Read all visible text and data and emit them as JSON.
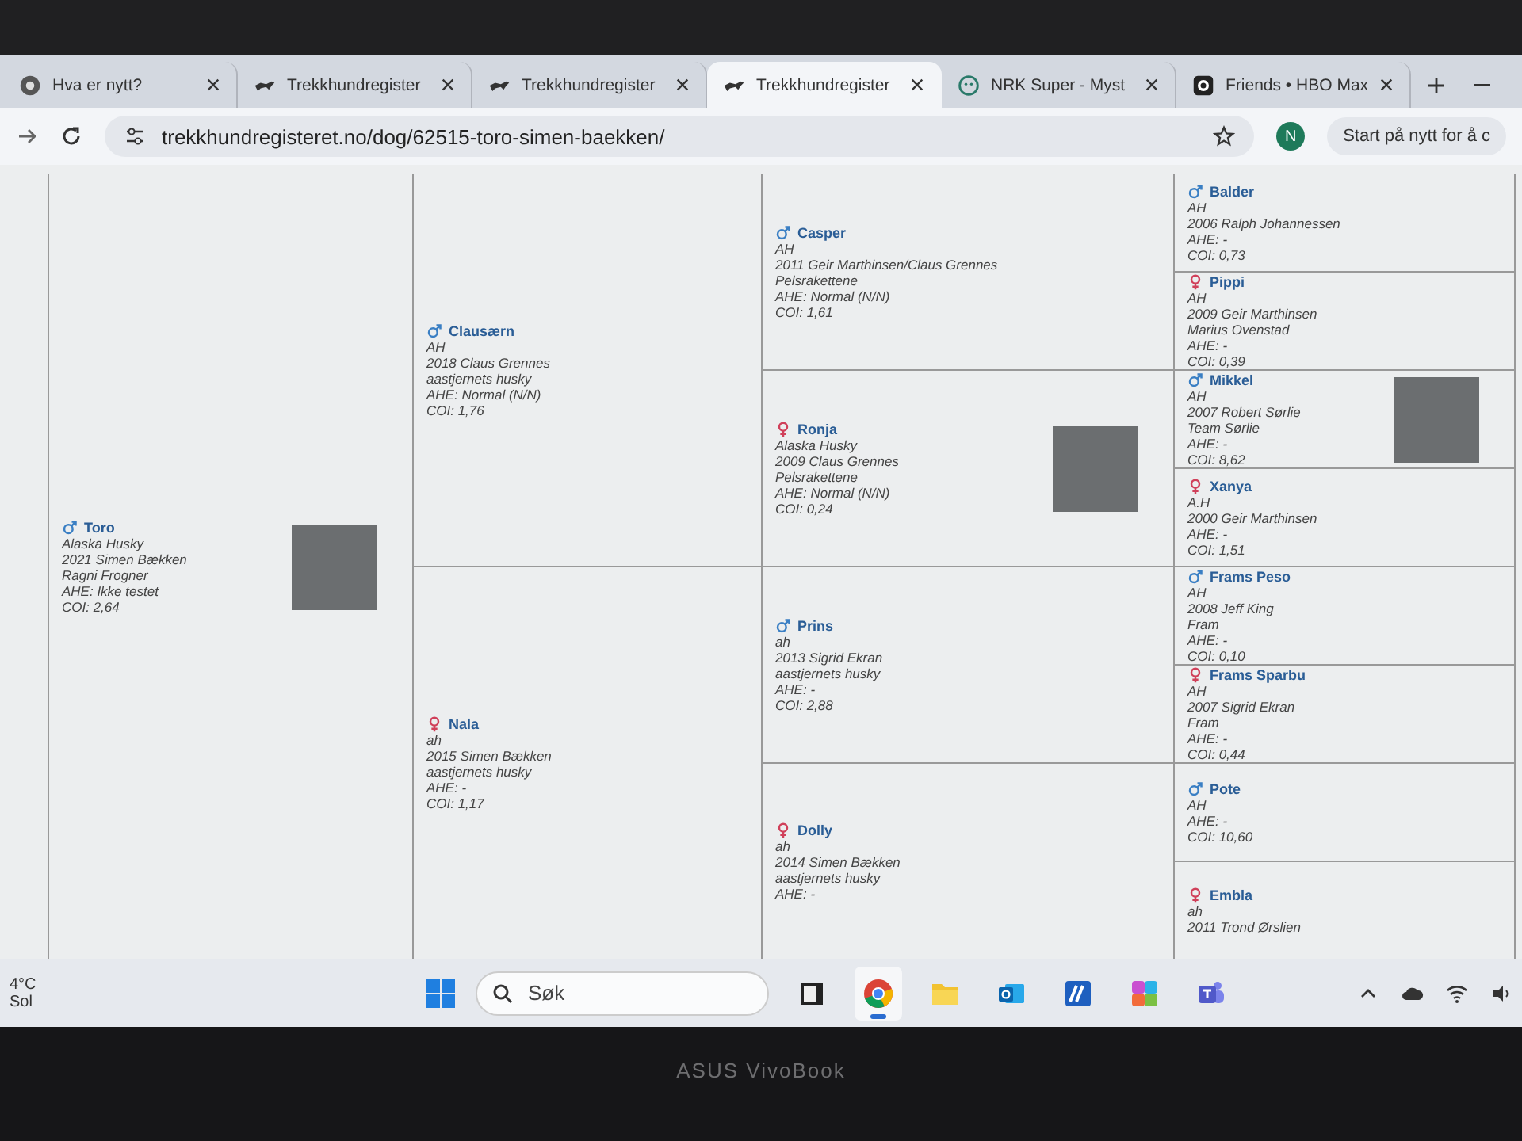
{
  "tabs": [
    {
      "title": "Hva er nytt?",
      "kind": "chrome",
      "selected": false
    },
    {
      "title": "Trekkhundregister",
      "kind": "dog",
      "selected": false
    },
    {
      "title": "Trekkhundregister",
      "kind": "dog",
      "selected": false
    },
    {
      "title": "Trekkhundregister",
      "kind": "dog",
      "selected": true
    },
    {
      "title": "NRK Super - Myst",
      "kind": "nrk",
      "selected": false
    },
    {
      "title": "Friends • HBO Max",
      "kind": "hbo",
      "selected": false
    }
  ],
  "address_bar": {
    "url": "trekkhundregisteret.no/dog/62515-toro-simen-baekken/",
    "profile_initial": "N",
    "restart_button": "Start på nytt for å c"
  },
  "pedigree": [
    {
      "dogs": [
        {
          "kind": "male",
          "name": "Toro",
          "photo": true,
          "lines": [
            "Alaska Husky",
            "2021 Simen Bækken",
            "Ragni Frogner",
            "AHE: Ikke testet",
            "COI: 2,64"
          ]
        }
      ]
    },
    {
      "dogs": [
        {
          "kind": "male",
          "name": "Clausærn",
          "photo": false,
          "lines": [
            "AH",
            "2018 Claus Grennes",
            "aastjernets husky",
            "AHE: Normal (N/N)",
            "COI: 1,76"
          ]
        },
        {
          "kind": "female",
          "name": "Nala",
          "photo": false,
          "lines": [
            "ah",
            "2015 Simen Bækken",
            "aastjernets husky",
            "AHE: -",
            "COI: 1,17"
          ]
        }
      ]
    },
    {
      "dogs": [
        {
          "kind": "male",
          "name": "Casper",
          "photo": false,
          "lines": [
            "AH",
            "2011 Geir Marthinsen/Claus Grennes",
            "Pelsrakettene",
            "AHE: Normal (N/N)",
            "COI: 1,61"
          ]
        },
        {
          "kind": "female",
          "name": "Ronja",
          "photo": true,
          "lines": [
            "Alaska Husky",
            "2009 Claus Grennes",
            "Pelsrakettene",
            "AHE: Normal (N/N)",
            "COI: 0,24"
          ]
        },
        {
          "kind": "male",
          "name": "Prins",
          "photo": false,
          "lines": [
            "ah",
            "2013 Sigrid Ekran",
            "aastjernets husky",
            "AHE: -",
            "COI: 2,88"
          ]
        },
        {
          "kind": "female",
          "name": "Dolly",
          "photo": false,
          "lines": [
            "ah",
            "2014 Simen Bækken",
            "aastjernets husky",
            "AHE: -"
          ]
        }
      ]
    },
    {
      "dogs": [
        {
          "kind": "male",
          "name": "Balder",
          "photo": false,
          "lines": [
            "AH",
            "2006 Ralph Johannessen",
            "AHE: -",
            "COI: 0,73"
          ]
        },
        {
          "kind": "female",
          "name": "Pippi",
          "photo": false,
          "lines": [
            "AH",
            "2009 Geir Marthinsen",
            "Marius Ovenstad",
            "AHE: -",
            "COI: 0,39"
          ]
        },
        {
          "kind": "male",
          "name": "Mikkel",
          "photo": true,
          "lines": [
            "AH",
            "2007 Robert Sørlie",
            "Team Sørlie",
            "AHE: -",
            "COI: 8,62"
          ]
        },
        {
          "kind": "female",
          "name": "Xanya",
          "photo": false,
          "lines": [
            "A.H",
            "2000 Geir Marthinsen",
            "AHE: -",
            "COI: 1,51"
          ]
        },
        {
          "kind": "male",
          "name": "Frams Peso",
          "photo": false,
          "lines": [
            "AH",
            "2008 Jeff King",
            "Fram",
            "AHE: -",
            "COI: 0,10"
          ]
        },
        {
          "kind": "female",
          "name": "Frams Sparbu",
          "photo": false,
          "lines": [
            "AH",
            "2007 Sigrid Ekran",
            "Fram",
            "AHE: -",
            "COI: 0,44"
          ]
        },
        {
          "kind": "male",
          "name": "Pote",
          "photo": false,
          "lines": [
            "AH",
            "AHE: -",
            "COI: 10,60"
          ]
        },
        {
          "kind": "female",
          "name": "Embla",
          "photo": false,
          "lines": [
            "ah",
            "2011 Trond Ørslien"
          ]
        }
      ]
    }
  ],
  "taskbar": {
    "weather": {
      "temperature": "4°C",
      "condition": "Sol"
    },
    "search": {
      "placeholder": "Søk"
    },
    "apps": [
      {
        "kind": "taskview",
        "selected": false
      },
      {
        "kind": "chrome",
        "selected": true
      },
      {
        "kind": "files",
        "selected": false
      },
      {
        "kind": "outlook",
        "selected": false
      },
      {
        "kind": "word",
        "selected": false
      },
      {
        "kind": "m365",
        "selected": false
      },
      {
        "kind": "teams",
        "selected": false
      }
    ]
  },
  "bezel_label": "ASUS VivoBook"
}
